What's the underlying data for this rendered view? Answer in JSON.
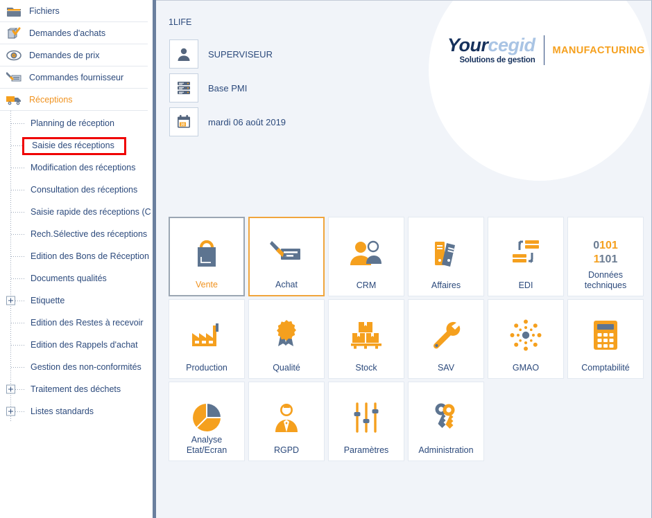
{
  "sidebar": {
    "top_items": [
      {
        "label": "Fichiers",
        "icon": "folder-icon",
        "active": false
      },
      {
        "label": "Demandes d'achats",
        "icon": "purchase-request-icon",
        "active": false
      },
      {
        "label": "Demandes de prix",
        "icon": "eye-icon",
        "active": false
      },
      {
        "label": "Commandes fournisseur",
        "icon": "supplier-order-icon",
        "active": false
      },
      {
        "label": "Réceptions",
        "icon": "truck-icon",
        "active": true
      }
    ],
    "tree_items": [
      {
        "label": "Planning de réception",
        "expandable": false,
        "highlighted": false
      },
      {
        "label": "Saisie des réceptions",
        "expandable": false,
        "highlighted": true
      },
      {
        "label": "Modification des réceptions",
        "expandable": false,
        "highlighted": false
      },
      {
        "label": "Consultation des réceptions",
        "expandable": false,
        "highlighted": false
      },
      {
        "label": "Saisie rapide des réceptions (C",
        "expandable": false,
        "highlighted": false
      },
      {
        "label": "Rech.Sélective des réceptions",
        "expandable": false,
        "highlighted": false
      },
      {
        "label": "Edition des Bons de Réception",
        "expandable": false,
        "highlighted": false
      },
      {
        "label": "Documents qualités",
        "expandable": false,
        "highlighted": false
      },
      {
        "label": "Etiquette",
        "expandable": true,
        "highlighted": false
      },
      {
        "label": "Edition des Restes à recevoir",
        "expandable": false,
        "highlighted": false
      },
      {
        "label": "Edition des Rappels d'achat",
        "expandable": false,
        "highlighted": false
      },
      {
        "label": "Gestion des non-conformités",
        "expandable": false,
        "highlighted": false
      },
      {
        "label": "Traitement des déchets",
        "expandable": true,
        "highlighted": false
      },
      {
        "label": "Listes standards",
        "expandable": true,
        "highlighted": false
      }
    ]
  },
  "header": {
    "site_code": "1LIFE",
    "info": [
      {
        "icon": "user-icon",
        "text": "SUPERVISEUR"
      },
      {
        "icon": "database-icon",
        "text": "Base PMI"
      },
      {
        "icon": "calendar-icon",
        "text": "mardi 06 août 2019"
      }
    ],
    "logo": {
      "word_primary": "Your",
      "word_secondary": "cegid",
      "tagline": "Solutions de gestion",
      "product": "MANUFACTURING"
    }
  },
  "tiles": [
    {
      "label": "Vente",
      "icon": "shopping-bag-icon",
      "state": "sel-grey"
    },
    {
      "label": "Achat",
      "icon": "cheque-pen-icon",
      "state": "sel-orange"
    },
    {
      "label": "CRM",
      "icon": "two-people-icon",
      "state": ""
    },
    {
      "label": "Affaires",
      "icon": "binders-icon",
      "state": ""
    },
    {
      "label": "EDI",
      "icon": "data-exchange-icon",
      "state": ""
    },
    {
      "label": "Données techniques",
      "icon": "binary-code-icon",
      "state": "",
      "binary": {
        "line1": [
          "0",
          "101"
        ],
        "line2": [
          "1",
          "101"
        ]
      }
    },
    {
      "label": "Production",
      "icon": "factory-icon",
      "state": ""
    },
    {
      "label": "Qualité",
      "icon": "quality-rosette-icon",
      "state": ""
    },
    {
      "label": "Stock",
      "icon": "boxes-pallet-icon",
      "state": ""
    },
    {
      "label": "SAV",
      "icon": "wrench-icon",
      "state": ""
    },
    {
      "label": "GMAO",
      "icon": "network-hub-icon",
      "state": ""
    },
    {
      "label": "Comptabilité",
      "icon": "calculator-icon",
      "state": ""
    },
    {
      "label": "Analyse Etat/Ecran",
      "icon": "pie-chart-icon",
      "state": "",
      "label_lines": [
        "Analyse",
        "Etat/Ecran"
      ]
    },
    {
      "label": "RGPD",
      "icon": "person-suit-icon",
      "state": ""
    },
    {
      "label": "Paramètres",
      "icon": "sliders-icon",
      "state": ""
    },
    {
      "label": "Administration",
      "icon": "keys-icon",
      "state": ""
    }
  ],
  "colors": {
    "orange": "#f5a01e",
    "navy": "#2c4a7c",
    "slate": "#6b7c92",
    "highlight_red": "#ef0000",
    "panel_bg": "#f1f4f9"
  }
}
